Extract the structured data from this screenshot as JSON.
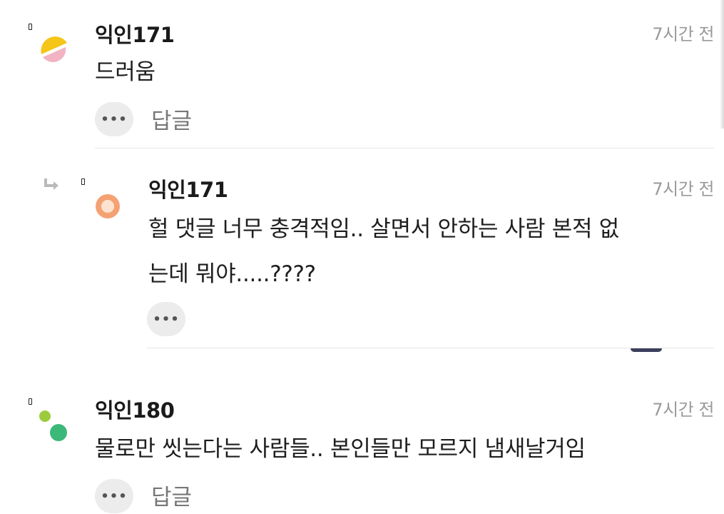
{
  "comments": [
    {
      "author": "익인171",
      "time": "7시간 전",
      "text": "드러움",
      "reply_label": "답글",
      "more_label": "•••"
    },
    {
      "author": "익인171",
      "time": "7시간 전",
      "text_line1": "헐 댓글 너무 충격적임.. 살면서 안하는 사람 본적 없",
      "text_line2": "는데 뭐야.....????",
      "more_label": "•••"
    },
    {
      "author": "익인180",
      "time": "7시간 전",
      "text": "물로만 씻는다는 사람들.. 본인들만 모르지 냄새날거임",
      "reply_label": "답글",
      "more_label": "•••"
    }
  ],
  "colors": {
    "avatar1_top": "#f5c518",
    "avatar1_bottom": "#f2b3c2",
    "avatar2_ring": "#f4a273",
    "avatar2_center": "#fde3cf",
    "avatar3_small": "#9ccc3d",
    "avatar3_large": "#3cb878"
  },
  "icons": [
    "reply-arrow-icon",
    "more-dots-icon"
  ]
}
